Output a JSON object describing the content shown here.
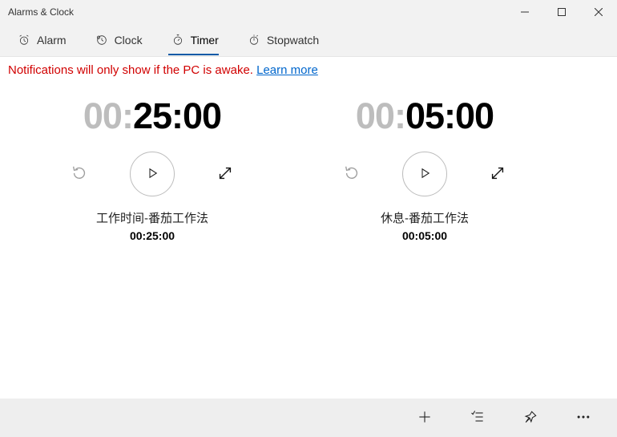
{
  "window": {
    "title": "Alarms & Clock"
  },
  "tabs": {
    "alarm": "Alarm",
    "clock": "Clock",
    "timer": "Timer",
    "stopwatch": "Stopwatch"
  },
  "notice": {
    "text": "Notifications will only show if the PC is awake. ",
    "link": "Learn more"
  },
  "timers": [
    {
      "hh": "00",
      "mm": "25",
      "ss": "00",
      "name": "工作时间-番茄工作法",
      "duration": "00:25:00"
    },
    {
      "hh": "00",
      "mm": "05",
      "ss": "00",
      "name": "休息-番茄工作法",
      "duration": "00:05:00"
    }
  ]
}
